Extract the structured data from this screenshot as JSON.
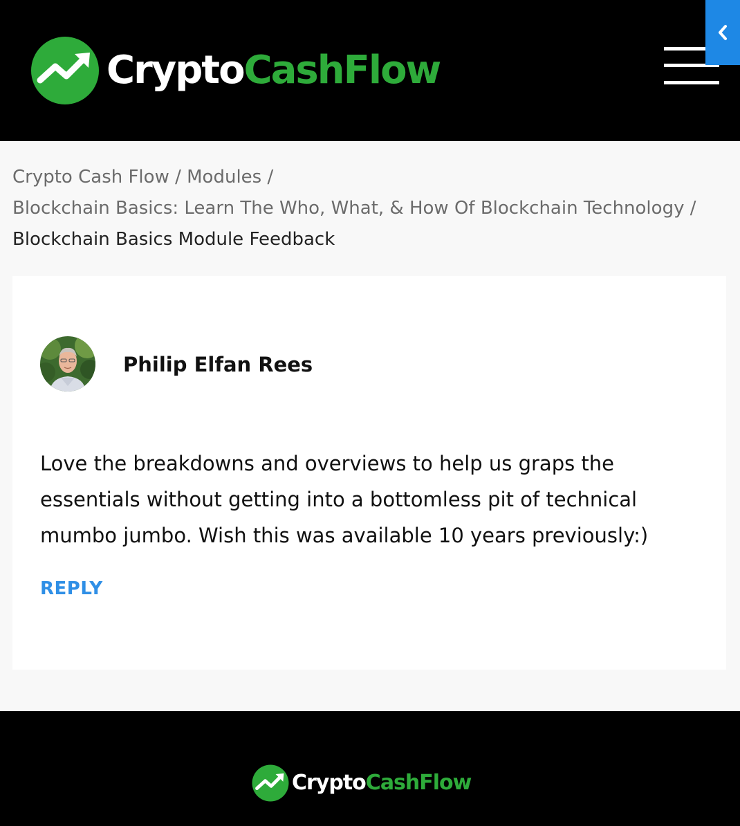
{
  "header": {
    "logo_text_white": "Crypto",
    "logo_text_green": "CashFlow"
  },
  "breadcrumb": {
    "items": [
      {
        "label": "Crypto Cash Flow"
      },
      {
        "label": "Modules"
      },
      {
        "label": "Blockchain Basics: Learn The Who, What, & How Of Blockchain Technology"
      }
    ],
    "separator": "/",
    "current": "Blockchain Basics Module Feedback"
  },
  "comment": {
    "author": "Philip Elfan Rees",
    "text": "Love the breakdowns and overviews to help us graps the essentials without getting into a bottomless pit of technical mumbo jumbo. Wish this was available 10 years previously:)",
    "reply_label": "REPLY"
  },
  "footer": {
    "logo_text_white": "Crypto",
    "logo_text_green": "CashFlow"
  },
  "colors": {
    "brand_green": "#2eab3a",
    "link_blue": "#2f8fe6",
    "side_tab_blue": "#1e88e5"
  },
  "icons": {
    "logo_mark": "trending-up-circle-icon",
    "menu": "hamburger-menu-icon",
    "side_tab": "chevron-left-icon"
  }
}
